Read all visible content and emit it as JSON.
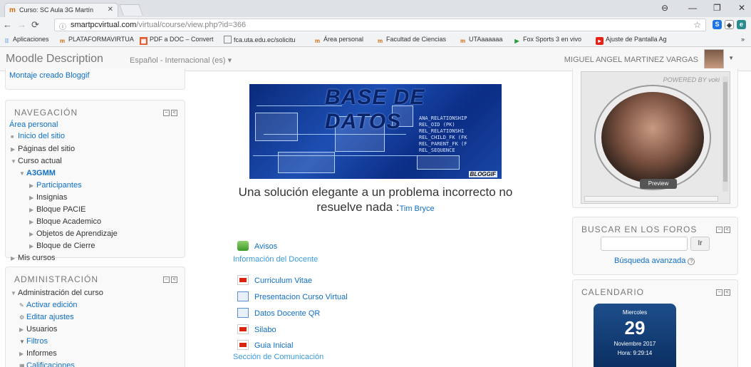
{
  "browser": {
    "tab_title": "Curso: SC Aula 3G Martín",
    "url_host": "smartpcvirtual.com",
    "url_path": "/virtual/course/view.php?id=366",
    "bookmarks": [
      "Aplicaciones",
      "PLATAFORMAVIRTUA",
      "PDF a DOC – Convert",
      "fca.uta.edu.ec/solicitu",
      "Área personal",
      "Facultad de Ciencias",
      "UTAaaaaaa",
      "Fox Sports 3 en vivo",
      "Ajuste de Pantalla Ag"
    ]
  },
  "header": {
    "brand": "Moodle Description",
    "language": "Español - Internacional (es) ▾",
    "user_name": "MIGUEL ANGEL MARTINEZ VARGAS"
  },
  "left": {
    "top_link": "Montaje creado Bloggif",
    "nav": {
      "heading": "NAVEGACIÓN",
      "items": [
        "Área personal",
        "Inicio del sitio",
        "Páginas del sitio",
        "Curso actual",
        "A3GMM",
        "Participantes",
        "Insignias",
        "Bloque PACIE",
        "Bloque Academico",
        "Objetos de Aprendizaje",
        "Bloque de Cierre",
        "Mis cursos"
      ]
    },
    "admin": {
      "heading": "ADMINISTRACIÓN",
      "items": [
        "Administración del curso",
        "Activar edición",
        "Editar ajustes",
        "Usuarios",
        "Filtros",
        "Informes",
        "Calificaciones"
      ]
    }
  },
  "center": {
    "banner_title": "BASE DE DATOS",
    "banner_watermark": "BLOGGIF",
    "banner_lines": [
      "ANA_RELATIONSHIP",
      "REL_OID (PK)",
      "REL_RELATIONSHI",
      "REL_CHILD_FK (FK",
      "REL_PARENT_FK (F",
      "REL_SEQUENCE"
    ],
    "quote": "Una solución elegante a un problema incorrecto no resuelve nada :",
    "quote_author": "Tim Bryce",
    "activities": {
      "avisos": "Avisos",
      "section1": "Información del Docente",
      "curriculum": "Curriculum Vitae",
      "presentacion": "Presentacion Curso Virtual",
      "datos_qr": "Datos Docente QR",
      "silabo": "Silabo",
      "guia": "Guia Inicial",
      "section2": "Sección de Comunicación"
    }
  },
  "right": {
    "powered": "POWERED BY voki",
    "preview": "Preview",
    "search_heading": "BUSCAR EN LOS FOROS",
    "go_label": "Ir",
    "advanced": "Búsqueda avanzada",
    "calendar_heading": "CALENDARIO",
    "cal_day": "Miercoles",
    "cal_num": "29",
    "cal_month": "Noviembre 2017",
    "cal_time": "Hora: 9:29:14"
  },
  "colors": {
    "link": "#0f6fc5",
    "section": "#3a9ad9",
    "calendar": "#1d4e8a"
  }
}
